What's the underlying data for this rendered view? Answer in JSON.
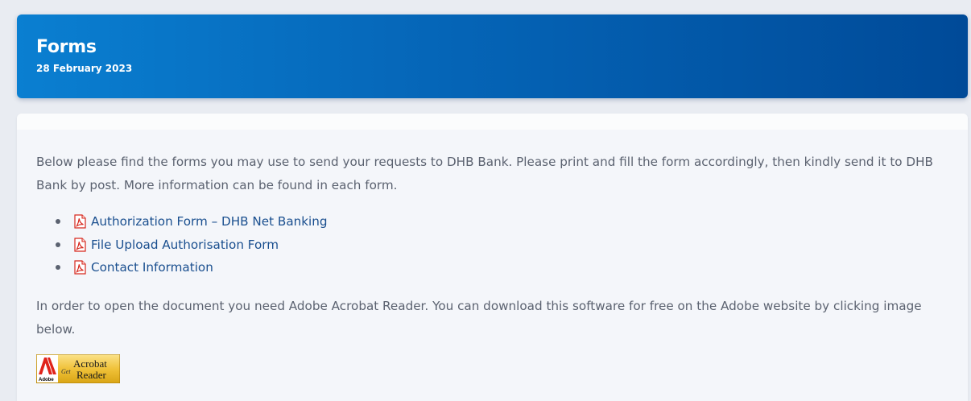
{
  "header": {
    "title": "Forms",
    "date": "28 February 2023"
  },
  "content": {
    "intro": "Below please find the forms you may use to send your requests to DHB Bank. Please print and fill the form accordingly, then kindly send it to DHB Bank by post. More information can be found in each form.",
    "forms": [
      {
        "label": "Authorization Form – DHB Net Banking",
        "icon": "pdf-icon"
      },
      {
        "label": "File Upload Authorisation Form",
        "icon": "pdf-icon"
      },
      {
        "label": "Contact Information",
        "icon": "pdf-icon"
      }
    ],
    "notice": "In order to open the document you need Adobe Acrobat Reader. You can download this software for free on the Adobe website by clicking image below.",
    "badge": {
      "brand": "Adobe",
      "get": "Get",
      "product_line1": "Acrobat",
      "product_line2": "Reader"
    }
  },
  "colors": {
    "header_gradient_start": "#0a7fd1",
    "header_gradient_end": "#004a98",
    "link": "#1a4f8f",
    "body_text": "#5b6270",
    "pdf_red": "#d6281e"
  }
}
